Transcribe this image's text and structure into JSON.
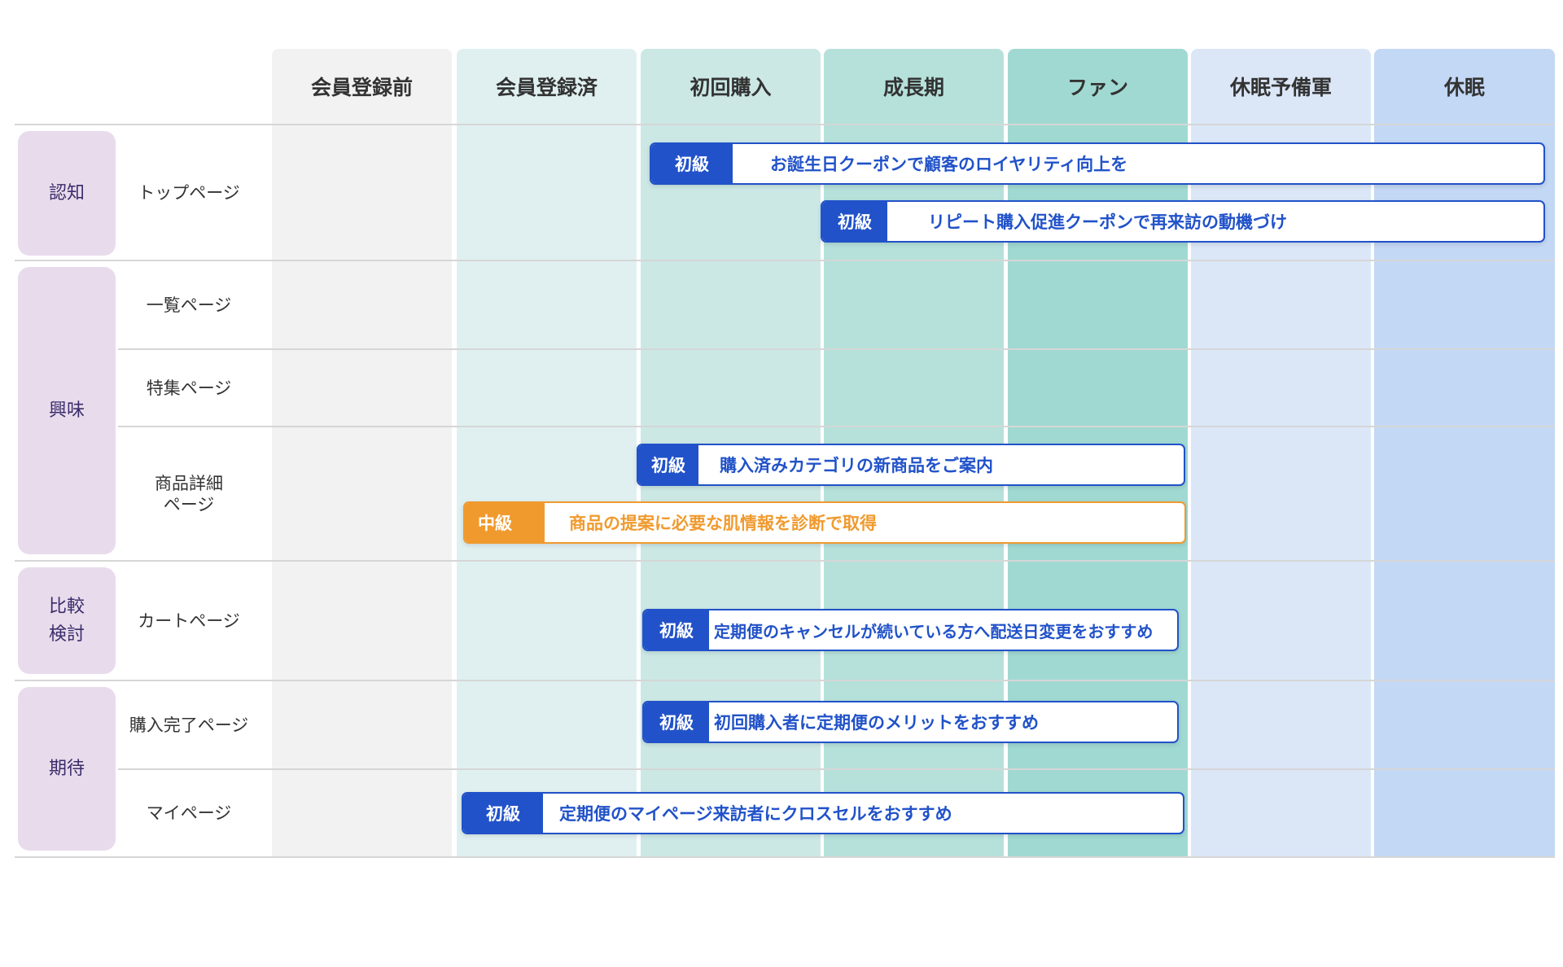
{
  "columns": [
    "会員登録前",
    "会員登録済",
    "初回購入",
    "成長期",
    "ファン",
    "休眠予備軍",
    "休眠"
  ],
  "stages": [
    "認知",
    "興味",
    "比較\n検討",
    "期待"
  ],
  "pages": [
    "トップページ",
    "一覧ページ",
    "特集ページ",
    "商品詳細\nページ",
    "カートページ",
    "購入完了ページ",
    "マイページ"
  ],
  "bars": [
    {
      "level": "初級",
      "text": "お誕生日クーポンで顧客のロイヤリティ向上を",
      "type": "beginner"
    },
    {
      "level": "初級",
      "text": "リピート購入促進クーポンで再来訪の動機づけ",
      "type": "beginner"
    },
    {
      "level": "初級",
      "text": "購入済みカテゴリの新商品をご案内",
      "type": "beginner"
    },
    {
      "level": "中級",
      "text": "商品の提案に必要な肌情報を診断で取得",
      "type": "intermediate"
    },
    {
      "level": "初級",
      "text": "定期便のキャンセルが続いている方へ配送日変更をおすすめ",
      "type": "beginner"
    },
    {
      "level": "初級",
      "text": "初回購入者に定期便のメリットをおすすめ",
      "type": "beginner"
    },
    {
      "level": "初級",
      "text": "定期便のマイページ来訪者にクロスセルをおすすめ",
      "type": "beginner"
    }
  ],
  "colors": {
    "beginner": "#2152c9",
    "intermediate": "#f09a2e",
    "stage_bg": "#e8dcec",
    "stage_text": "#3a2d6b"
  }
}
